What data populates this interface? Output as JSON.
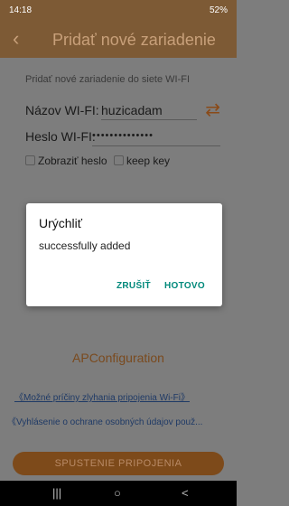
{
  "status_bar": {
    "time": "14:18",
    "time_icon": "image-icon",
    "right_text": "52%",
    "right_icons": [
      "alarm-icon",
      "wifi-icon",
      "signal-icon",
      "battery-icon"
    ]
  },
  "header": {
    "title": "Pridať nové zariadenie",
    "back_icon": "back-arrow-icon"
  },
  "form": {
    "subtitle": "Pridať nové zariadenie do siete WI-FI",
    "wifi_label": "Názov WI-FI:",
    "wifi_value": "huzicadam",
    "swap_icon": "swap-icon",
    "password_label": "Heslo WI-FI:",
    "password_value": "••••••••••••••",
    "show_password_label": "Zobraziť heslo",
    "keep_key_label": "keep key"
  },
  "dialog": {
    "title": "Urýchliť",
    "message": "successfully added",
    "cancel_label": "ZRUŠIŤ",
    "ok_label": "HOTOVO"
  },
  "ap_configuration": "APConfiguration",
  "links": {
    "wifi_failure": "《Možné príčiny zlyhania pripojenia Wi-Fi》",
    "privacy": "《Vyhlásenie o ochrane osobných údajov použ..."
  },
  "start_button": "SPUSTENIE PRIPOJENIA",
  "nav_bar": {
    "recent": "|||",
    "home": "○",
    "back": "<"
  },
  "colors": {
    "header_bg": "#7d5a35",
    "accent": "#7d4a1a",
    "dialog_button": "#00897b",
    "overlay_bg": "#7d7d7d"
  }
}
